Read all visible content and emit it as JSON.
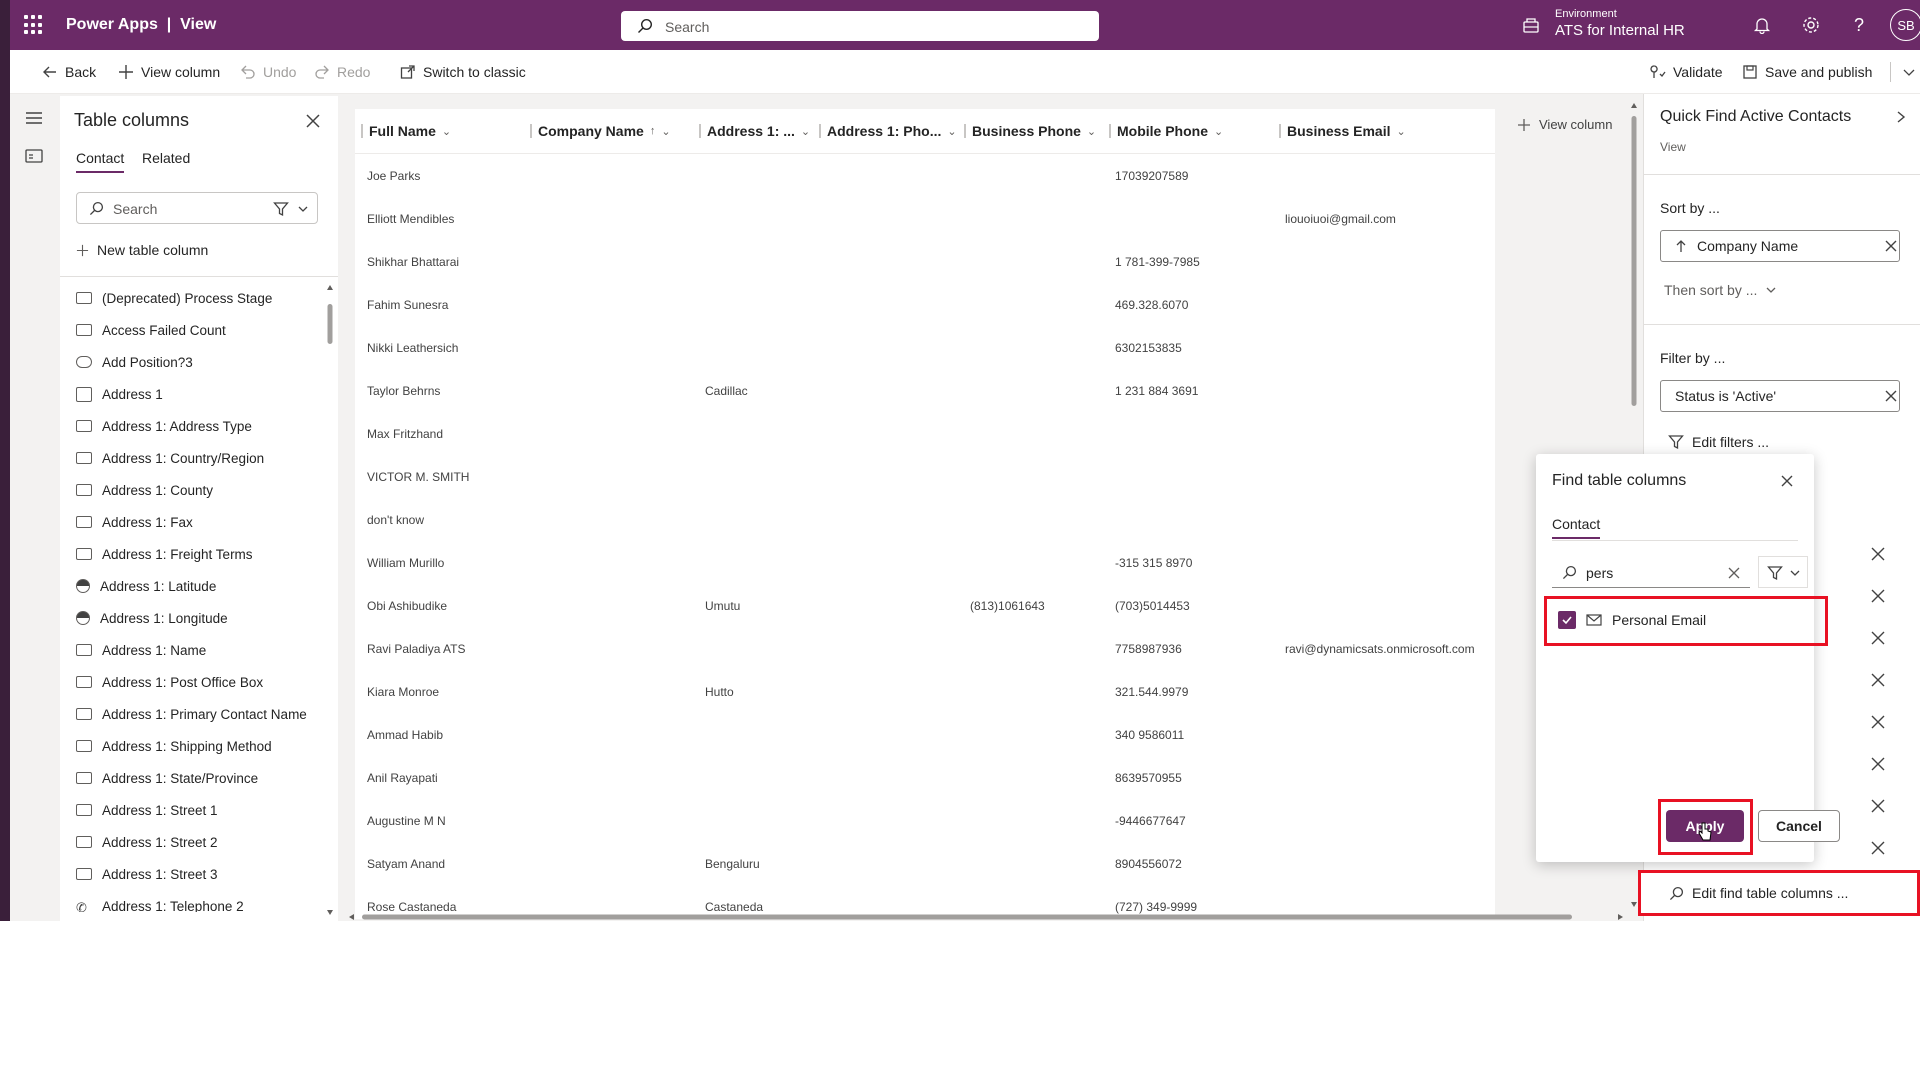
{
  "topbar": {
    "brand": "Power Apps  |  View",
    "search_placeholder": "Search",
    "env_label": "Environment",
    "env_name": "ATS for Internal HR",
    "avatar": "SB"
  },
  "cmd": {
    "back": "Back",
    "view_column": "View column",
    "undo": "Undo",
    "redo": "Redo",
    "switch_classic": "Switch to classic",
    "validate": "Validate",
    "save_publish": "Save and publish"
  },
  "colpanel": {
    "title": "Table columns",
    "tabs": [
      "Contact",
      "Related"
    ],
    "search_placeholder": "Search",
    "new_column": "New table column",
    "items": [
      "(Deprecated) Process Stage",
      "Access Failed Count",
      "Add Position?3",
      "Address 1",
      "Address 1: Address Type",
      "Address 1: Country/Region",
      "Address 1: County",
      "Address 1: Fax",
      "Address 1: Freight Terms",
      "Address 1: Latitude",
      "Address 1: Longitude",
      "Address 1: Name",
      "Address 1: Post Office Box",
      "Address 1: Primary Contact Name",
      "Address 1: Shipping Method",
      "Address 1: State/Province",
      "Address 1: Street 1",
      "Address 1: Street 2",
      "Address 1: Street 3",
      "Address 1: Telephone 2"
    ]
  },
  "grid": {
    "headers": [
      "Full Name",
      "Company Name",
      "Address 1: ...",
      "Address 1: Pho...",
      "Business Phone",
      "Mobile Phone",
      "Business Email"
    ],
    "rows": [
      [
        "Joe Parks",
        "",
        "",
        "",
        "",
        "17039207589",
        ""
      ],
      [
        "Elliott Mendibles",
        "",
        "",
        "",
        "",
        "",
        "liouoiuoi@gmail.com"
      ],
      [
        "Shikhar Bhattarai",
        "",
        "",
        "",
        "",
        "1 781-399-7985",
        ""
      ],
      [
        "Fahim Sunesra",
        "",
        "",
        "",
        "",
        "469.328.6070",
        ""
      ],
      [
        "Nikki Leathersich",
        "",
        "",
        "",
        "",
        "6302153835",
        ""
      ],
      [
        "Taylor Behrns",
        "",
        "Cadillac",
        "",
        "",
        "1 231 884 3691",
        ""
      ],
      [
        "Max Fritzhand",
        "",
        "",
        "",
        "",
        "",
        ""
      ],
      [
        "VICTOR M. SMITH",
        "",
        "",
        "",
        "",
        "",
        ""
      ],
      [
        "don't know",
        "",
        "",
        "",
        "",
        "",
        ""
      ],
      [
        "William Murillo",
        "",
        "",
        "",
        "",
        "-315 315 8970",
        ""
      ],
      [
        "Obi Ashibudike",
        "",
        "Umutu",
        "",
        "(813)1061643",
        "(703)5014453",
        ""
      ],
      [
        "Ravi Paladiya ATS",
        "",
        "",
        "",
        "",
        "7758987936",
        "ravi@dynamicsats.onmicrosoft.com"
      ],
      [
        "Kiara Monroe",
        "",
        "Hutto",
        "",
        "",
        "321.544.9979",
        ""
      ],
      [
        "Ammad Habib",
        "",
        "",
        "",
        "",
        "340 9586011",
        ""
      ],
      [
        "Anil Rayapati",
        "",
        "",
        "",
        "",
        "8639570955",
        ""
      ],
      [
        "Augustine M N",
        "",
        "",
        "",
        "",
        "-9446677647",
        ""
      ],
      [
        "Satyam Anand",
        "",
        "Bengaluru",
        "",
        "",
        "8904556072",
        ""
      ],
      [
        "Rose Castaneda",
        "",
        "Castaneda",
        "",
        "",
        "(727) 349-9999",
        ""
      ]
    ],
    "view_column": "View column"
  },
  "rightpanel": {
    "title": "Quick Find Active Contacts",
    "subtitle": "View",
    "sort_label": "Sort by ...",
    "sort_value": "Company Name",
    "then_sort": "Then sort by ...",
    "filter_label": "Filter by ...",
    "filter_value": "Status is 'Active'",
    "edit_filters": "Edit filters ...",
    "edit_find": "Edit find table columns ..."
  },
  "findpanel": {
    "title": "Find table columns",
    "tab": "Contact",
    "search_value": "pers",
    "option": "Personal Email",
    "apply": "Apply",
    "cancel": "Cancel"
  },
  "colors": {
    "accent": "#6b2a67",
    "highlight": "#e81123"
  }
}
